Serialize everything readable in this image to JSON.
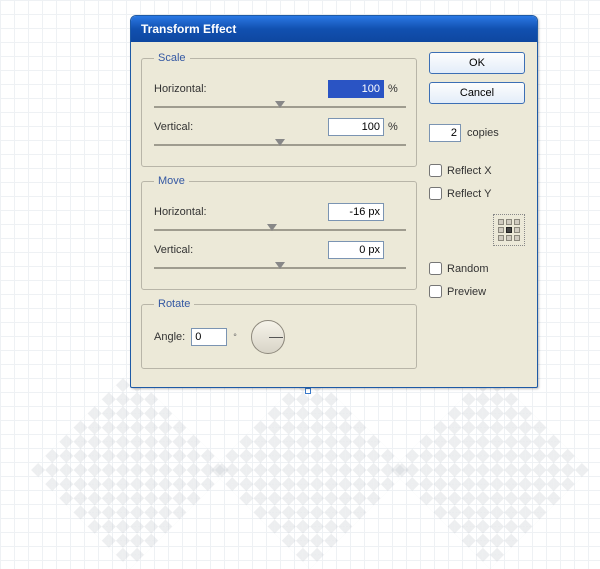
{
  "dialog": {
    "title": "Transform Effect",
    "buttons": {
      "ok": "OK",
      "cancel": "Cancel"
    }
  },
  "scale": {
    "legend": "Scale",
    "horizontal_label": "Horizontal:",
    "horizontal_value": "100",
    "horizontal_unit": "%",
    "vertical_label": "Vertical:",
    "vertical_value": "100",
    "vertical_unit": "%"
  },
  "move": {
    "legend": "Move",
    "horizontal_label": "Horizontal:",
    "horizontal_value": "-16 px",
    "vertical_label": "Vertical:",
    "vertical_value": "0 px"
  },
  "rotate": {
    "legend": "Rotate",
    "angle_label": "Angle:",
    "angle_value": "0",
    "angle_unit": "°"
  },
  "options": {
    "copies_value": "2",
    "copies_label": "copies",
    "reflect_x": "Reflect X",
    "reflect_y": "Reflect Y",
    "random": "Random",
    "preview": "Preview"
  }
}
